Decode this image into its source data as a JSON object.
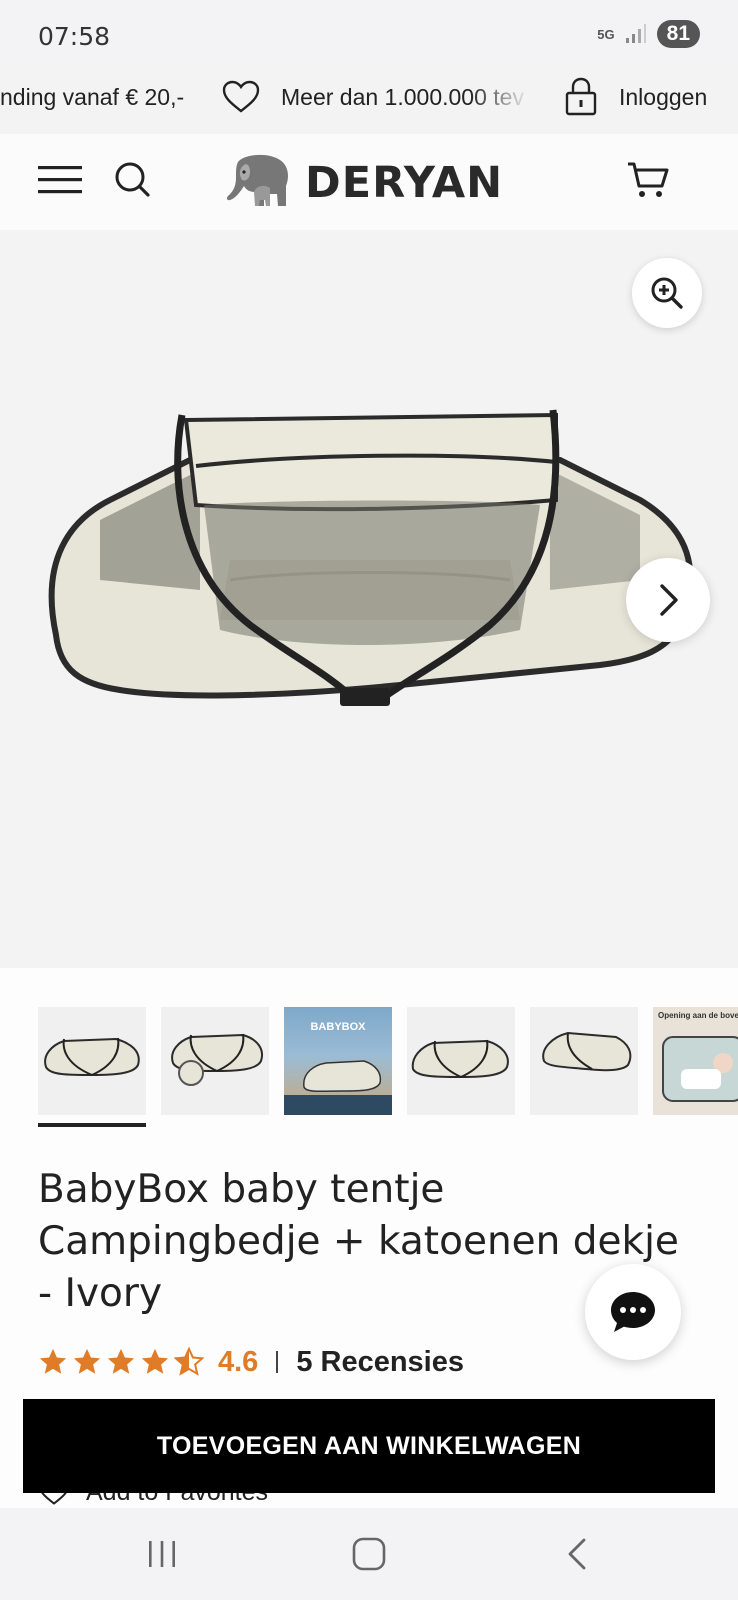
{
  "status_bar": {
    "time": "07:58",
    "network": "5G",
    "battery": "81"
  },
  "promo_bar": {
    "item1": "nding vanaf € 20,-",
    "item2": "Meer dan 1.000.000 tev",
    "login": "Inloggen"
  },
  "header": {
    "brand": "DERYAN"
  },
  "gallery": {
    "thumbnail_banner_text": "BABYBOX",
    "thumbnail_last_text": "Opening aan de bovenkant"
  },
  "product": {
    "title": "BabyBox baby tentje Campingbedje + katoenen dekje - Ivory",
    "rating_value": "4.6",
    "rating_stars": 4.6,
    "reviews": "5 Recensies",
    "favorites_label": "Add to Favorites",
    "add_to_cart_label": "TOEVOEGEN AAN WINKELWAGEN"
  },
  "colors": {
    "accent_star": "#e07b27",
    "cart_button": "#000000"
  }
}
